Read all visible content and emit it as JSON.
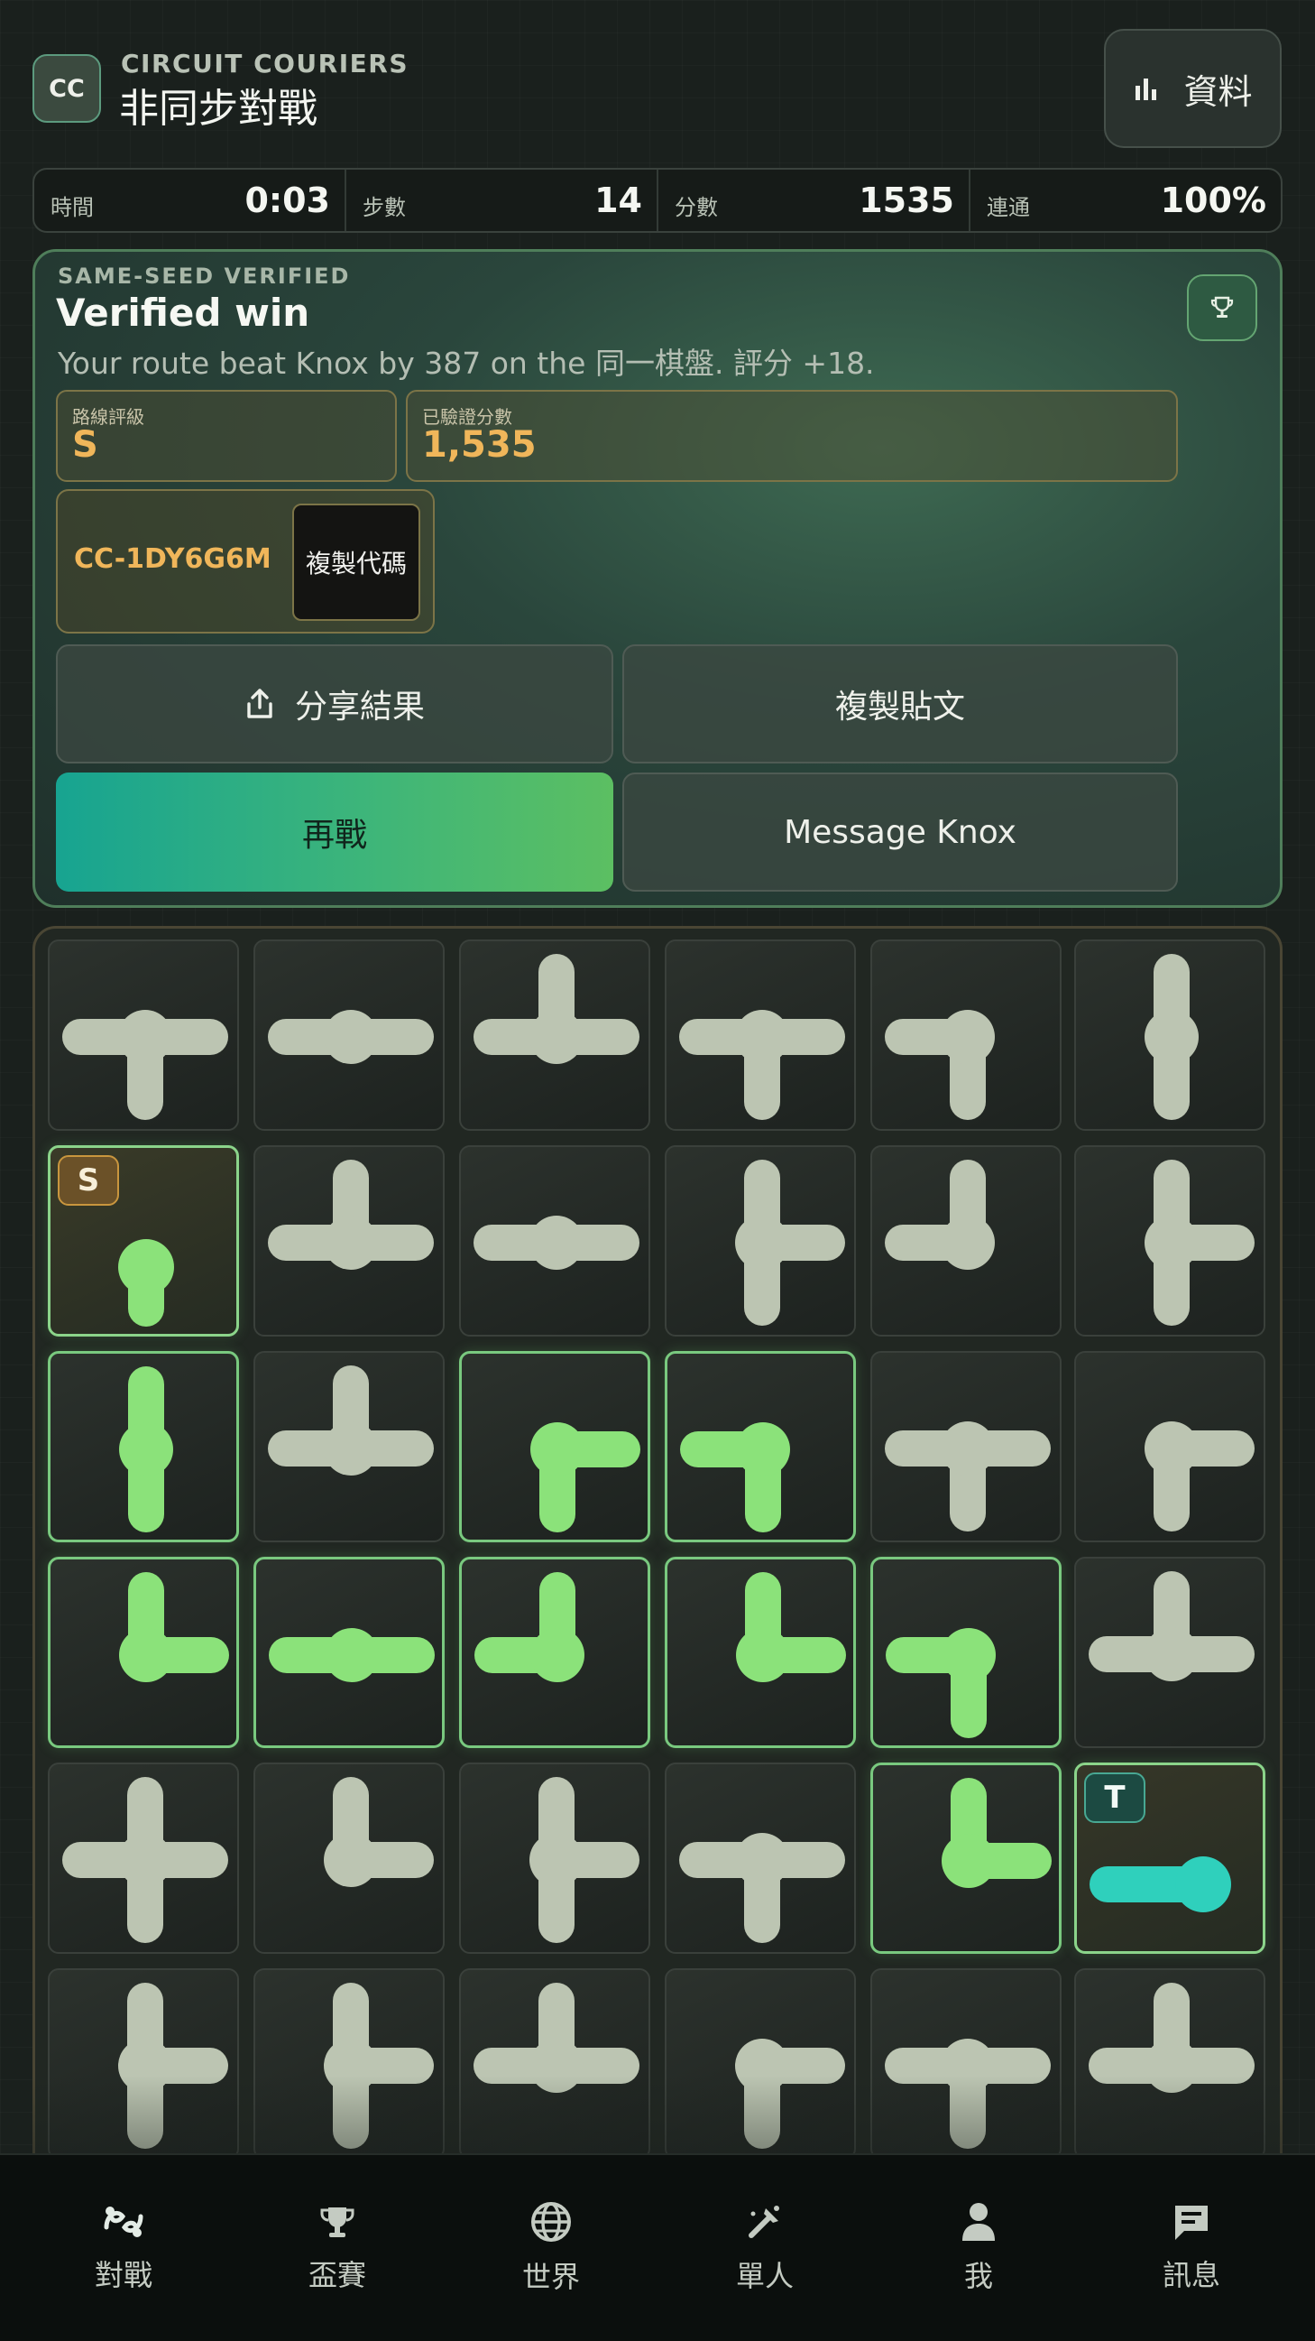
{
  "header": {
    "logo_text": "CC",
    "kicker": "CIRCUIT COURIERS",
    "title": "非同步對戰",
    "data_button_label": "資料",
    "data_button_icon": "bar-chart-icon"
  },
  "stats": [
    {
      "label": "時間",
      "value": "0:03"
    },
    {
      "label": "步數",
      "value": "14"
    },
    {
      "label": "分數",
      "value": "1535"
    },
    {
      "label": "連通",
      "value": "100%"
    }
  ],
  "result": {
    "kicker": "SAME-SEED VERIFIED",
    "title": "Verified win",
    "subtitle": "Your route beat Knox by 387 on the 同一棋盤. 評分 +18.",
    "trophy_icon": "trophy-icon",
    "grade_label": "路線評級",
    "grade_value": "S",
    "score_label": "已驗證分數",
    "score_value": "1,535",
    "code": "CC-1DY6G6M",
    "copy_code_label": "複製代碼",
    "share_label": "分享結果",
    "share_icon": "share-icon",
    "copy_post_label": "複製貼文",
    "rematch_label": "再戰",
    "message_label": "Message Knox"
  },
  "board": {
    "rows": 6,
    "cols": 6,
    "start_tag": "S",
    "target_tag": "T",
    "colors": {
      "pipe": "#bcc5b2",
      "lit": "#8be27a",
      "target": "#2fd0bc"
    },
    "tiles": [
      [
        "lrd",
        "lr",
        "lru",
        "lrd",
        "ld",
        "ud"
      ],
      [
        "d",
        "lru",
        "lr",
        "urd",
        "ul",
        "urd"
      ],
      [
        "ud",
        "lru",
        "rd",
        "ld",
        "lrd",
        "rd"
      ],
      [
        "ur",
        "lr",
        "ul",
        "ur",
        "ld",
        "lru"
      ],
      [
        "urdl",
        "ur",
        "urd",
        "lrd",
        "ur",
        "r"
      ],
      [
        "urd",
        "urd",
        "lru",
        "rd",
        "lrd",
        "lru"
      ]
    ],
    "lit": [
      [
        false,
        false,
        false,
        false,
        false,
        false
      ],
      [
        true,
        false,
        false,
        false,
        false,
        false
      ],
      [
        true,
        false,
        true,
        true,
        false,
        false
      ],
      [
        true,
        true,
        true,
        true,
        true,
        false
      ],
      [
        false,
        false,
        false,
        false,
        true,
        true
      ],
      [
        false,
        false,
        false,
        false,
        false,
        false
      ]
    ],
    "start": [
      1,
      0
    ],
    "target": [
      4,
      5
    ]
  },
  "nav": {
    "items": [
      {
        "label": "對戰",
        "icon": "versus-icon",
        "active": true
      },
      {
        "label": "盃賽",
        "icon": "trophy-icon",
        "active": false
      },
      {
        "label": "世界",
        "icon": "globe-icon",
        "active": false
      },
      {
        "label": "單人",
        "icon": "tools-icon",
        "active": false
      },
      {
        "label": "我",
        "icon": "person-icon",
        "active": false
      },
      {
        "label": "訊息",
        "icon": "message-icon",
        "active": false
      }
    ]
  }
}
